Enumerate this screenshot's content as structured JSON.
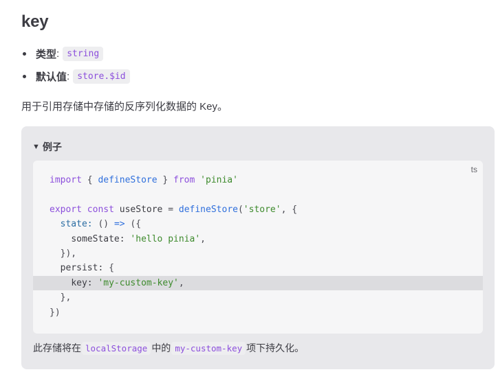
{
  "heading": "key",
  "bullets": [
    {
      "label": "类型",
      "colon": ":",
      "code": "string"
    },
    {
      "label": "默认值",
      "colon": ":",
      "code": "store.$id"
    }
  ],
  "description": "用于引用存储中存储的反序列化数据的 Key。",
  "example": {
    "summary_marker": "▼",
    "summary_label": "例子",
    "language": "ts",
    "code_lines": [
      {
        "text": "import { defineStore } from 'pinia'",
        "highlighted": false
      },
      {
        "text": "",
        "highlighted": false
      },
      {
        "text": "export const useStore = defineStore('store', {",
        "highlighted": false
      },
      {
        "text": "  state: () => ({",
        "highlighted": false
      },
      {
        "text": "    someState: 'hello pinia',",
        "highlighted": false
      },
      {
        "text": "  }),",
        "highlighted": false
      },
      {
        "text": "  persist: {",
        "highlighted": false
      },
      {
        "text": "    key: 'my-custom-key',",
        "highlighted": true
      },
      {
        "text": "  },",
        "highlighted": false
      },
      {
        "text": "})",
        "highlighted": false
      }
    ],
    "footer": {
      "before": "此存储将在",
      "code1": "localStorage",
      "middle": "中的",
      "code2": "my-custom-key",
      "after": "项下持久化。"
    }
  },
  "colors": {
    "text": "#3c3c43",
    "inline_code": "#8c4fdc",
    "keyword": "#8c4fdc",
    "function": "#2f6fdc",
    "string": "#3d8a2c",
    "details_bg": "#e8e8eb",
    "code_bg": "#f6f6f7",
    "highlight_bg": "#dcdcdf"
  }
}
